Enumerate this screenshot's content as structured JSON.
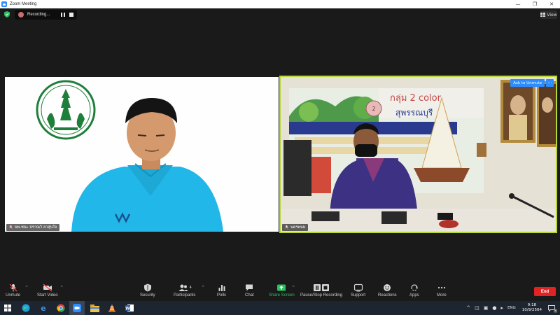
{
  "window": {
    "title": "Zoom Meeting"
  },
  "top_bar": {
    "recording_label": "Recording...",
    "view_label": "View"
  },
  "participants": [
    {
      "name": "นพ.ชนะ ปราณวิ ลาสุ่นใจ",
      "muted": true
    },
    {
      "name": "นครพนม",
      "muted": true,
      "ask_to_unmute": "Ask to Unmute",
      "active_speaker": true
    }
  ],
  "right_video": {
    "banner_number": "2",
    "banner_line1": "กลุ่ม 2 color",
    "banner_line2": "สุพรรณบุรี"
  },
  "toolbar": {
    "unmute": "Unmute",
    "start_video": "Start Video",
    "security": "Security",
    "participants": "Participants",
    "participants_count": "4",
    "polls": "Polls",
    "chat": "Chat",
    "share_screen": "Share Screen",
    "pause_stop_recording": "Pause/Stop Recording",
    "support": "Support",
    "reactions": "Reactions",
    "apps": "Apps",
    "more": "More",
    "end": "End"
  },
  "taskbar": {
    "language": "ENG",
    "time": "9:18",
    "date": "10/9/2564",
    "notification_count": "8"
  },
  "colors": {
    "zoom_blue": "#2d8cff",
    "end_red": "#e02424",
    "share_green": "#2fbf62",
    "active_speaker_border": "#b7d738"
  }
}
